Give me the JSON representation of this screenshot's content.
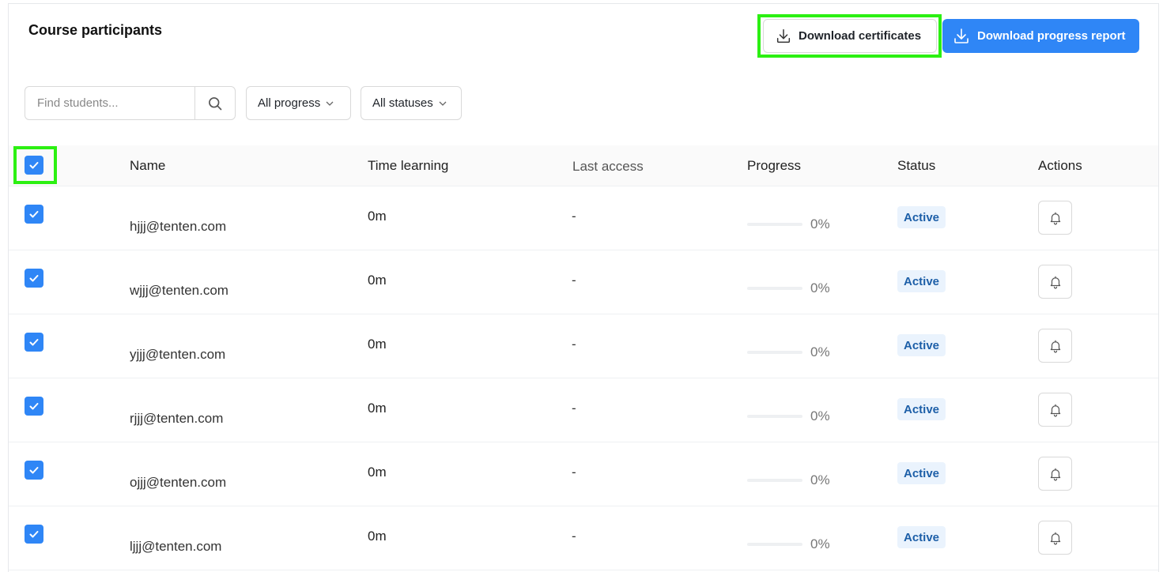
{
  "header": {
    "title": "Course participants",
    "download_certificates_label": "Download certificates",
    "download_report_label": "Download progress report"
  },
  "filters": {
    "search_placeholder": "Find students...",
    "progress_value": "All progress",
    "status_value": "All statuses"
  },
  "table": {
    "columns": {
      "name": "Name",
      "time": "Time learning",
      "last_access": "Last access",
      "progress": "Progress",
      "status": "Status",
      "actions": "Actions"
    },
    "select_all_checked": true,
    "rows": [
      {
        "email": "hjjj@tenten.com",
        "time": "0m",
        "last_access": "-",
        "progress": 0,
        "progress_label": "0%",
        "status": "Active",
        "checked": true
      },
      {
        "email": "wjjj@tenten.com",
        "time": "0m",
        "last_access": "-",
        "progress": 0,
        "progress_label": "0%",
        "status": "Active",
        "checked": true
      },
      {
        "email": "yjjj@tenten.com",
        "time": "0m",
        "last_access": "-",
        "progress": 0,
        "progress_label": "0%",
        "status": "Active",
        "checked": true
      },
      {
        "email": "rjjj@tenten.com",
        "time": "0m",
        "last_access": "-",
        "progress": 0,
        "progress_label": "0%",
        "status": "Active",
        "checked": true
      },
      {
        "email": "ojjj@tenten.com",
        "time": "0m",
        "last_access": "-",
        "progress": 0,
        "progress_label": "0%",
        "status": "Active",
        "checked": true
      },
      {
        "email": "ljjj@tenten.com",
        "time": "0m",
        "last_access": "-",
        "progress": 0,
        "progress_label": "0%",
        "status": "Active",
        "checked": true
      }
    ]
  },
  "colors": {
    "accent": "#2f86f6",
    "highlight": "#2cf012",
    "badge_bg": "#eaf3fd",
    "badge_text": "#1d5fa8"
  },
  "icons": {
    "download": "download-icon",
    "search": "search-icon",
    "chevron": "chevron-down-icon",
    "check": "check-icon",
    "bell": "bell-icon"
  }
}
